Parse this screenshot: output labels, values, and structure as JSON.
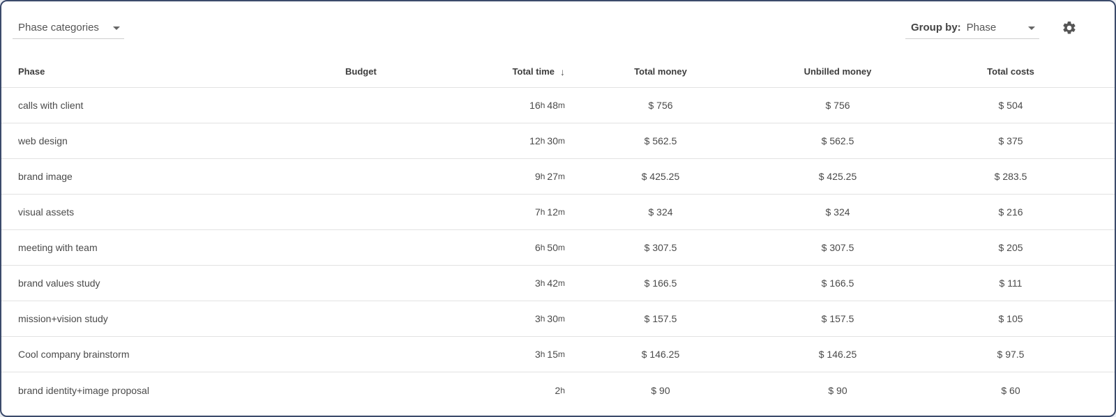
{
  "toolbar": {
    "category_dropdown": {
      "value": "Phase categories"
    },
    "group_by": {
      "label": "Group by:",
      "value": "Phase"
    },
    "settings_icon": "gear-icon"
  },
  "table": {
    "headers": {
      "phase": "Phase",
      "budget": "Budget",
      "total_time": "Total time",
      "total_money": "Total money",
      "unbilled_money": "Unbilled money",
      "total_costs": "Total costs"
    },
    "sort": {
      "column": "total_time",
      "direction": "desc",
      "icon": "arrow-down-icon"
    },
    "rows": [
      {
        "phase": "calls with client",
        "budget": "",
        "hours": "16",
        "minutes": "48",
        "total_money": "$ 756",
        "unbilled_money": "$ 756",
        "total_costs": "$ 504"
      },
      {
        "phase": "web design",
        "budget": "",
        "hours": "12",
        "minutes": "30",
        "total_money": "$ 562.5",
        "unbilled_money": "$ 562.5",
        "total_costs": "$ 375"
      },
      {
        "phase": "brand image",
        "budget": "",
        "hours": "9",
        "minutes": "27",
        "total_money": "$ 425.25",
        "unbilled_money": "$ 425.25",
        "total_costs": "$ 283.5"
      },
      {
        "phase": "visual assets",
        "budget": "",
        "hours": "7",
        "minutes": "12",
        "total_money": "$ 324",
        "unbilled_money": "$ 324",
        "total_costs": "$ 216"
      },
      {
        "phase": "meeting with team",
        "budget": "",
        "hours": "6",
        "minutes": "50",
        "total_money": "$ 307.5",
        "unbilled_money": "$ 307.5",
        "total_costs": "$ 205"
      },
      {
        "phase": "brand values study",
        "budget": "",
        "hours": "3",
        "minutes": "42",
        "total_money": "$ 166.5",
        "unbilled_money": "$ 166.5",
        "total_costs": "$ 111"
      },
      {
        "phase": "mission+vision study",
        "budget": "",
        "hours": "3",
        "minutes": "30",
        "total_money": "$ 157.5",
        "unbilled_money": "$ 157.5",
        "total_costs": "$ 105"
      },
      {
        "phase": "Cool company brainstorm",
        "budget": "",
        "hours": "3",
        "minutes": "15",
        "total_money": "$ 146.25",
        "unbilled_money": "$ 146.25",
        "total_costs": "$ 97.5"
      },
      {
        "phase": "brand identity+image proposal",
        "budget": "",
        "hours": "2",
        "minutes": "",
        "total_money": "$ 90",
        "unbilled_money": "$ 90",
        "total_costs": "$ 60"
      }
    ]
  }
}
